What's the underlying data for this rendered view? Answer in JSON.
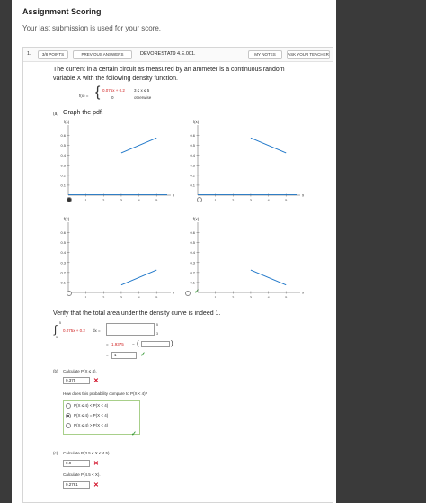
{
  "header": {
    "title": "Assignment Scoring",
    "subtitle": "Your last submission is used for your score."
  },
  "question": {
    "number": "1.",
    "points": "3/8 POINTS",
    "prev_answers": "PREVIOUS ANSWERS",
    "id": "DEVORESTAT9 4.E.001.",
    "my_notes": "MY NOTES",
    "ask_teacher": "ASK YOUR TEACHER",
    "prompt_line1": "The current in a certain circuit as measured by an ammeter is a continuous random",
    "prompt_line2": "variable X with the following density function.",
    "fx_label": "f(x) =",
    "piece1_expr": "0.075x + 0.2",
    "piece1_cond": "3 ≤ x ≤ 5",
    "piece2_expr": "0",
    "piece2_cond": "otherwise"
  },
  "part_a": {
    "label": "(a)",
    "instruction": "Graph the pdf.",
    "graph_ylabel": "f(x)",
    "graph_xlabel": "x",
    "yticks": [
      "0.6",
      "0.5",
      "0.4",
      "0.3",
      "0.2",
      "0.1"
    ],
    "xticks": [
      "1",
      "2",
      "3",
      "4",
      "5"
    ]
  },
  "verify": {
    "text": "Verify that the total area under the density curve is indeed 1.",
    "integrand": "0.075x + 0.2",
    "dx": "dx =",
    "upper": "5",
    "lower": "3",
    "bar_upper": "5",
    "bar_lower": "3",
    "line2_prefix": "=",
    "line2_value": "1.9375",
    "line2_minus": "−",
    "line3_prefix": "=",
    "line3_value": "1"
  },
  "part_b": {
    "label": "(b)",
    "calc_text": "Calculate P(X ≤ 4).",
    "answer": "0.375",
    "compare_text": "How does this probability compare to P(X < 4)?",
    "options": [
      "P(X ≤ 4) < P(X < 4)",
      "P(X ≤ 4) = P(X < 4)",
      "P(X ≤ 4) > P(X < 4)"
    ],
    "selected_index": 1
  },
  "part_c": {
    "label": "(c)",
    "calc_text1": "Calculate P(3.5 ≤ X ≤ 4.5).",
    "answer1": "0.9",
    "calc_text2": "Calculate P(4.5 < X).",
    "answer2": "0.2781"
  },
  "icons": {
    "x_mark": "✕",
    "check_mark": "✓"
  },
  "colors": {
    "line": "#1f77c9",
    "error": "#d0021b",
    "correct": "#3a9a3a"
  }
}
